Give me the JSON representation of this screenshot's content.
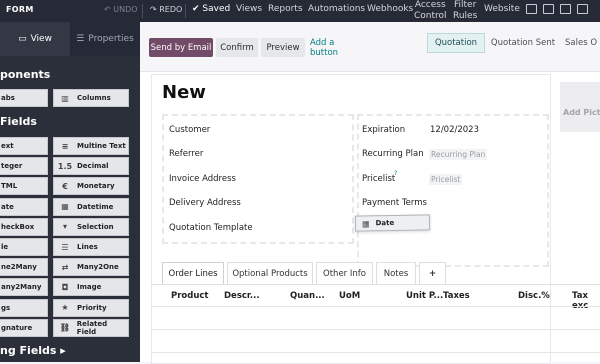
{
  "topbar": {
    "title": "FORM",
    "undo": "↶ UNDO",
    "redo": "↷ REDO",
    "saved": "✔ Saved",
    "menu": [
      "Views",
      "Reports",
      "Automations",
      "Webhooks"
    ],
    "access_control": [
      "Access",
      "Control"
    ],
    "filter_rules": [
      "Filter",
      "Rules"
    ],
    "website": "Website"
  },
  "sidebar": {
    "tabs": [
      {
        "label": "View",
        "icon": "view-icon"
      },
      {
        "label": "Properties",
        "icon": "properties-icon"
      }
    ],
    "components_heading": "ponents",
    "fields_heading": "Fields",
    "existing_heading": "ng Fields ▸",
    "components": [
      {
        "label": "abs",
        "icon": ""
      },
      {
        "label": "Columns",
        "icon": "columns-icon"
      }
    ],
    "fields_left": [
      "ext",
      "teger",
      "TML",
      "ate",
      "heckBox",
      "le",
      "ne2Many",
      "any2Many",
      "gs",
      "gnature"
    ],
    "fields_right": [
      {
        "label": "Multine Text",
        "glyph": "≡"
      },
      {
        "label": "Decimal",
        "glyph": "1.5"
      },
      {
        "label": "Monetary",
        "glyph": "€"
      },
      {
        "label": "Datetime",
        "glyph": "▦"
      },
      {
        "label": "Selection",
        "glyph": "▾"
      },
      {
        "label": "Lines",
        "glyph": "☰"
      },
      {
        "label": "Many2One",
        "glyph": "⇄"
      },
      {
        "label": "Image",
        "glyph": "◘"
      },
      {
        "label": "Priority",
        "glyph": "★"
      },
      {
        "label": "Related Field",
        "glyph": "⛓"
      }
    ]
  },
  "actions": {
    "send_email": "Send by Email",
    "confirm": "Confirm",
    "preview": "Preview",
    "add_button": "Add a button"
  },
  "statusbar": [
    "Quotation",
    "Quotation Sent",
    "Sales O"
  ],
  "form": {
    "title": "New",
    "picture": "Add Pictu",
    "left_fields": [
      "Customer",
      "Referrer",
      "Invoice Address",
      "Delivery Address",
      "Quotation Template"
    ],
    "expiration_label": "Expiration",
    "expiration_value": "12/02/2023",
    "recurring_label": "Recurring Plan",
    "recurring_placeholder": "Recurring Plan",
    "pricelist_label": "Pricelist",
    "pricelist_help": "?",
    "pricelist_placeholder": "Pricelist",
    "payment_terms_label": "Payment Terms",
    "dragged_field": "Date"
  },
  "tabs": [
    "Order Lines",
    "Optional Products",
    "Other Info",
    "Notes",
    "+"
  ],
  "table_headers": [
    "Product",
    "Descr...",
    "Quan...",
    "UoM",
    "Unit P...",
    "Taxes",
    "Disc.%",
    "Tax exc"
  ],
  "colors": {
    "primary": "#714b67",
    "teal": "#017e84",
    "sidebar": "#2b2f3a",
    "topbar": "#262a36"
  }
}
